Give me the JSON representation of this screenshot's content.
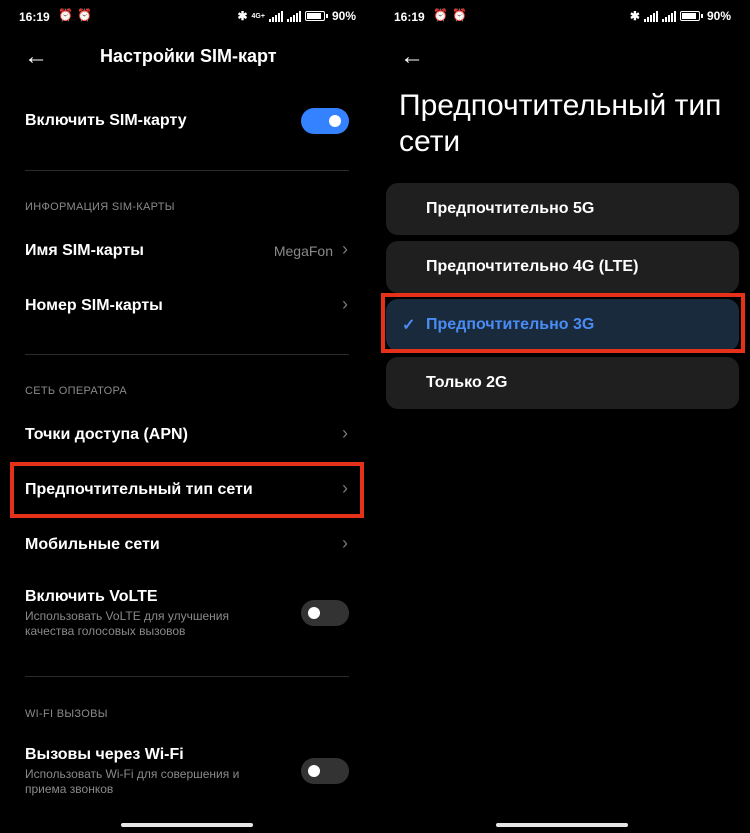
{
  "status_left": {
    "time": "16:19",
    "network": "4G+",
    "battery": "90"
  },
  "status_right": {
    "time": "16:19",
    "battery": "90"
  },
  "left": {
    "title": "Настройки SIM-карт",
    "enable_sim": {
      "label": "Включить SIM-карту",
      "on": true
    },
    "section_info": "ИНФОРМАЦИЯ SIM-КАРТЫ",
    "sim_name": {
      "label": "Имя SIM-карты",
      "value": "MegaFon"
    },
    "sim_number": {
      "label": "Номер SIM-карты"
    },
    "section_operator": "СЕТЬ ОПЕРАТОРА",
    "apn": {
      "label": "Точки доступа (APN)"
    },
    "preferred_network": {
      "label": "Предпочтительный тип сети"
    },
    "mobile_networks": {
      "label": "Мобильные сети"
    },
    "volte": {
      "label": "Включить VoLTE",
      "sub": "Использовать VoLTE для улучшения качества голосовых вызовов",
      "on": false
    },
    "section_wifi": "WI-FI ВЫЗОВЫ",
    "wifi_calls": {
      "label": "Вызовы через Wi-Fi",
      "sub": "Использовать Wi-Fi для совершения и приема звонков",
      "on": false
    }
  },
  "right": {
    "title": "Предпочтительный тип сети",
    "options": [
      {
        "label": "Предпочтительно 5G",
        "selected": false
      },
      {
        "label": "Предпочтительно 4G (LTE)",
        "selected": false
      },
      {
        "label": "Предпочтительно 3G",
        "selected": true
      },
      {
        "label": "Только 2G",
        "selected": false
      }
    ]
  },
  "colors": {
    "accent": "#3482ff",
    "selected_text": "#4a8cf5",
    "highlight": "#e5301a",
    "background": "#000000"
  }
}
